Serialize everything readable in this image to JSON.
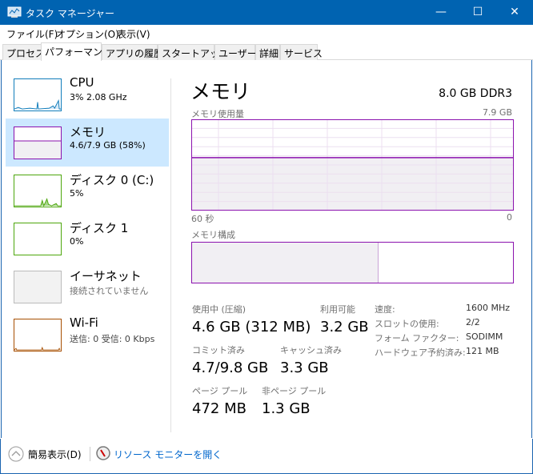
{
  "window": {
    "title": "タスク マネージャー",
    "minimize": "—",
    "maximize": "☐",
    "close": "✕"
  },
  "menu": [
    "ファイル(F)",
    "オプション(O)",
    "表示(V)"
  ],
  "tabs": [
    "プロセス",
    "パフォーマンス",
    "アプリの履歴",
    "スタートアップ",
    "ユーザー",
    "詳細",
    "サービス"
  ],
  "sidebar": [
    {
      "name": "CPU",
      "sub": "3%  2.08 GHz",
      "color": "#117dbb"
    },
    {
      "name": "メモリ",
      "sub": "4.6/7.9 GB (58%)",
      "color": "#8b12ae",
      "selected": true
    },
    {
      "name": "ディスク 0 (C:)",
      "sub": "5%",
      "color": "#4da60c"
    },
    {
      "name": "ディスク 1",
      "sub": "0%",
      "color": "#4da60c"
    },
    {
      "name": "イーサネット",
      "sub": "接続されていません",
      "color": "#bbbbbb"
    },
    {
      "name": "Wi-Fi",
      "sub": "送信: 0 受信: 0 Kbps",
      "color": "#a74f01"
    }
  ],
  "main": {
    "title": "メモリ",
    "spec": "8.0 GB DDR3",
    "usage_label": "メモリ使用量",
    "usage_max": "7.9 GB",
    "usage_percent": 58,
    "time_left": "60 秒",
    "time_right": "0",
    "composition_label": "メモリ構成",
    "composition_in_use_percent": 58,
    "stats": {
      "in_use_label": "使用中 (圧縮)",
      "in_use": "4.6 GB (312 MB)",
      "available_label": "利用可能",
      "available": "3.2 GB",
      "committed_label": "コミット済み",
      "committed": "4.7/9.8 GB",
      "cached_label": "キャッシュ済み",
      "cached": "3.3 GB",
      "paged_label": "ページ プール",
      "paged": "472 MB",
      "nonpaged_label": "非ページ プール",
      "nonpaged": "1.3 GB"
    },
    "details": [
      {
        "k": "速度:",
        "v": "1600 MHz"
      },
      {
        "k": "スロットの使用:",
        "v": "2/2"
      },
      {
        "k": "フォーム ファクター:",
        "v": "SODIMM"
      },
      {
        "k": "ハードウェア予約済み:",
        "v": "121 MB"
      }
    ]
  },
  "footer": {
    "fewer_details": "簡易表示(D)",
    "resource_monitor": "リソース モニターを開く"
  }
}
